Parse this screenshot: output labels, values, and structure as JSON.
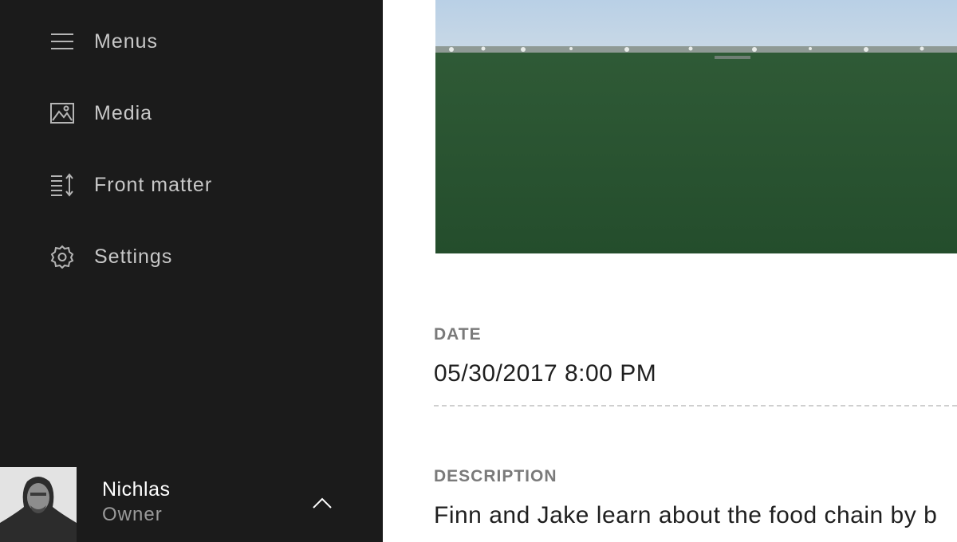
{
  "sidebar": {
    "items": [
      {
        "label": "Menus",
        "icon": "menu-icon"
      },
      {
        "label": "Media",
        "icon": "image-icon"
      },
      {
        "label": "Front matter",
        "icon": "sort-list-icon"
      },
      {
        "label": "Settings",
        "icon": "gear-icon"
      }
    ],
    "user": {
      "name": "Nichlas",
      "role": "Owner"
    }
  },
  "fields": {
    "date": {
      "label": "DATE",
      "value": "05/30/2017 8:00 PM"
    },
    "description": {
      "label": "DESCRIPTION",
      "value": "Finn and Jake learn about the food chain by b"
    }
  },
  "colors": {
    "sidebar_bg": "#1b1b1b",
    "sidebar_text": "#c8c8c8",
    "label_gray": "#7a7a7a"
  }
}
